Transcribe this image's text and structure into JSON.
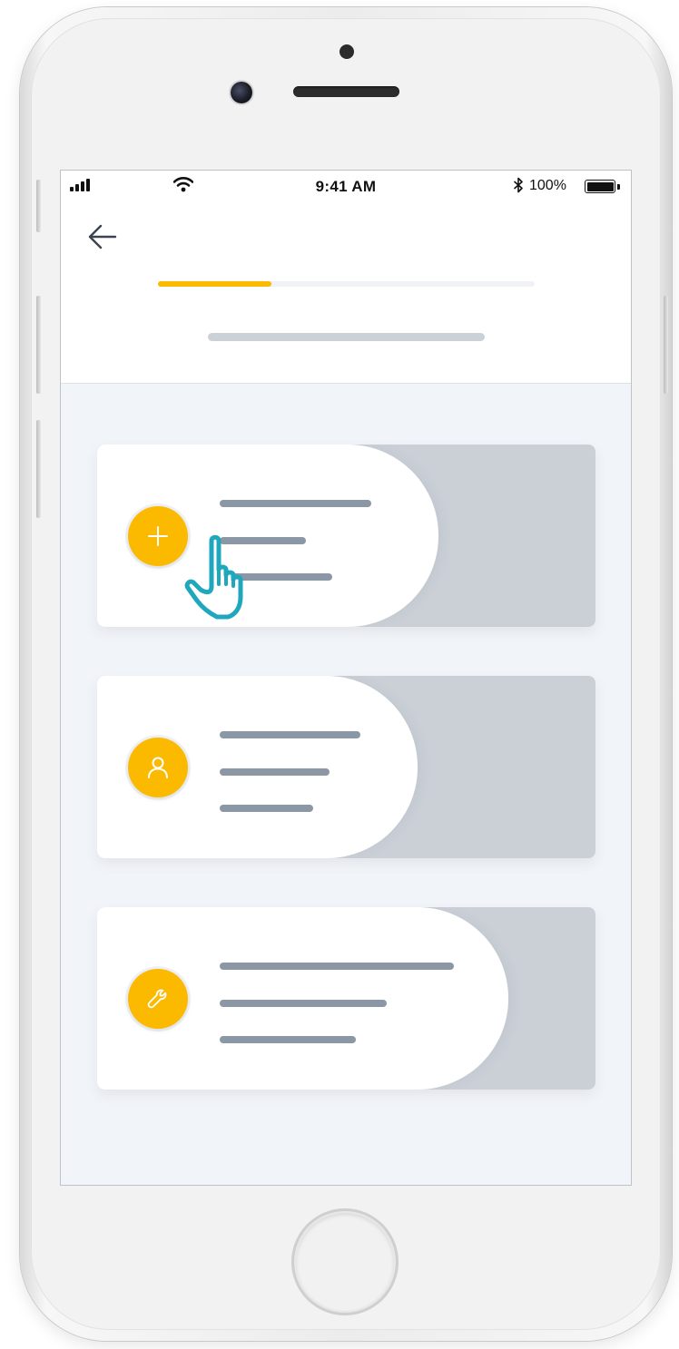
{
  "status_bar": {
    "time": "9:41 AM",
    "battery_percent": "100%",
    "signal_icon": "cellular-signal-icon",
    "wifi_icon": "wifi-icon",
    "bluetooth_icon": "bluetooth-icon",
    "battery_icon": "battery-full-icon"
  },
  "header": {
    "back_icon": "arrow-left-icon",
    "progress": 0.3
  },
  "colors": {
    "accent": "#fbba00",
    "card_back": "#cbd0d7",
    "skeleton_line": "#8b97a4",
    "cursor": "#1fa8bd"
  },
  "cards": [
    {
      "icon": "plus-icon"
    },
    {
      "icon": "user-icon"
    },
    {
      "icon": "wrench-icon"
    }
  ],
  "pointer": {
    "icon": "hand-pointer-icon"
  }
}
